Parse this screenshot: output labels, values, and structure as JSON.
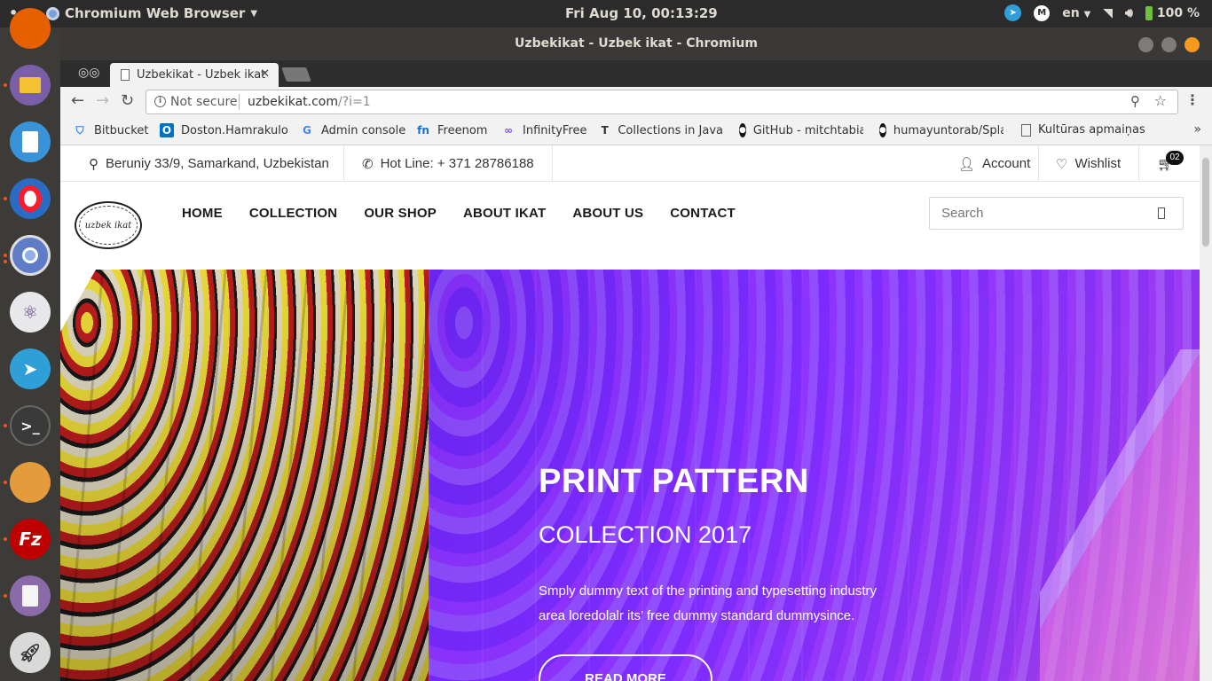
{
  "top_panel": {
    "app_name": "Chromium Web Browser",
    "clock": "Fri Aug 10, 00:13:29",
    "language": "en",
    "battery": "100 %"
  },
  "window": {
    "title": "Uzbekikat - Uzbek ikat - Chromium"
  },
  "tab": {
    "title": "Uzbekikat - Uzbek ikat"
  },
  "omnibox": {
    "security": "Not secure",
    "host": "uzbekikat.com",
    "path": "/?i=1"
  },
  "bookmarks": [
    {
      "label": "Bitbucket",
      "icon": "bitbucket-icon",
      "color": "#2684ff"
    },
    {
      "label": "Doston.Hamrakulo",
      "icon": "outlook-icon",
      "color": "#0072c6"
    },
    {
      "label": "Admin console",
      "icon": "google-icon",
      "color": "#4285f4"
    },
    {
      "label": "Freenom",
      "icon": "freenom-icon",
      "color": "#1a73c8"
    },
    {
      "label": "InfinityFree",
      "icon": "infinity-icon",
      "color": "#7c4dff"
    },
    {
      "label": "Collections in Java",
      "icon": "text-icon",
      "color": "#333333"
    },
    {
      "label": "GitHub - mitchtabia",
      "icon": "github-icon",
      "color": "#111111"
    },
    {
      "label": "humayuntorab/Spla",
      "icon": "github-icon",
      "color": "#111111"
    },
    {
      "label": "Kultūras apmaiņas",
      "icon": "doc-icon",
      "color": "#555555"
    }
  ],
  "site": {
    "address": "Beruniy 33/9, Samarkand, Uzbekistan",
    "hotline": "Hot Line: + 371 28786188",
    "account": "Account",
    "wishlist": "Wishlist",
    "cart_count": "02",
    "logo_text": "uzbek ikat",
    "nav": [
      "HOME",
      "COLLECTION",
      "OUR SHOP",
      "ABOUT IKAT",
      "ABOUT US",
      "CONTACT"
    ],
    "search_placeholder": "Search"
  },
  "hero": {
    "title": "PRINT PATTERN",
    "subtitle": "COLLECTION 2017",
    "text_line1": "Smply dummy text of the printing and typesetting industry",
    "text_line2": "area loredolalr its’ free dummy standard dummysince.",
    "button": "READ MORE"
  },
  "colors": {
    "ubuntu_accent": "#e95420",
    "hero_purple": "#7d2cff"
  }
}
